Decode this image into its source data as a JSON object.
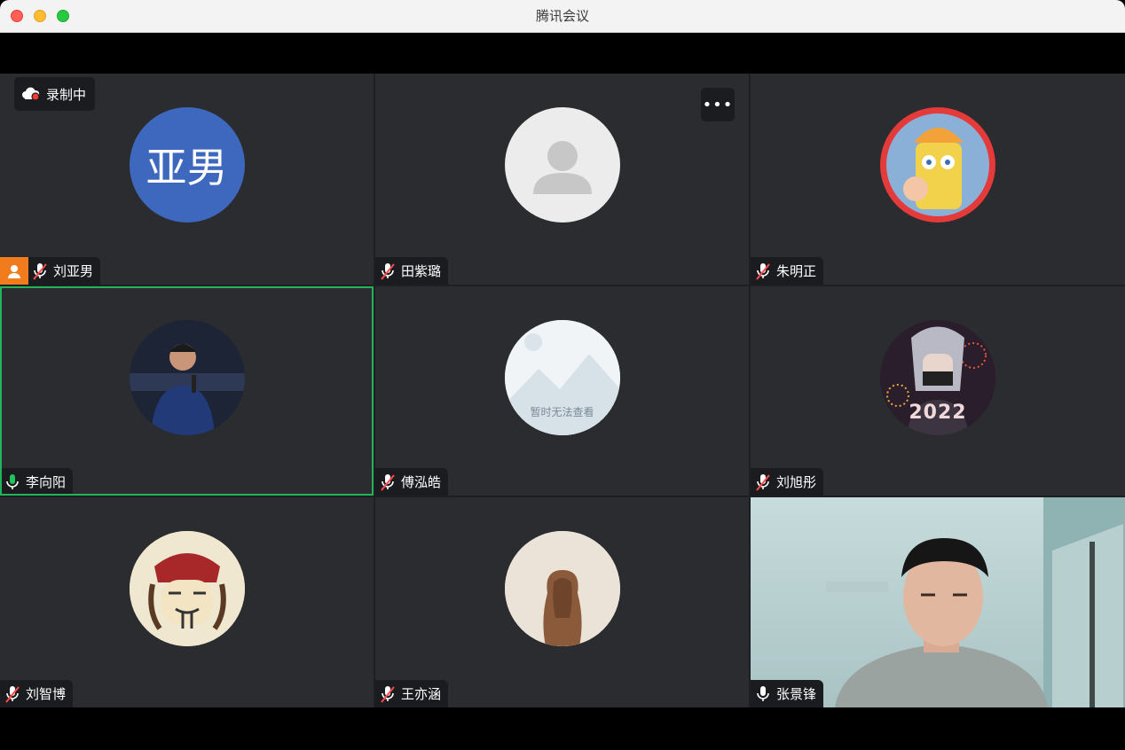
{
  "window": {
    "title": "腾讯会议"
  },
  "recording": {
    "label": "录制中"
  },
  "more_button": {
    "label": "•••"
  },
  "participants": [
    {
      "name": "刘亚男",
      "initials": "亚男",
      "mic": "muted",
      "host": true,
      "avatar": "initials-avatar"
    },
    {
      "name": "田紫璐",
      "mic": "muted",
      "avatar": "default-person-avatar"
    },
    {
      "name": "朱明正",
      "mic": "muted",
      "avatar": "cartoon-avatar"
    },
    {
      "name": "李向阳",
      "mic": "active",
      "speaking": true,
      "avatar": "photo-avatar"
    },
    {
      "name": "傅泓皓",
      "mic": "muted",
      "avatar": "unavailable-image-avatar",
      "avatar_text": "暂时无法查看"
    },
    {
      "name": "刘旭彤",
      "mic": "muted",
      "avatar": "anime-avatar",
      "avatar_text": "2022"
    },
    {
      "name": "刘智博",
      "mic": "muted",
      "avatar": "cartoon-pirate-avatar"
    },
    {
      "name": "王亦涵",
      "mic": "muted",
      "avatar": "photo-avatar"
    },
    {
      "name": "张景锋",
      "mic": "on",
      "avatar": "live-camera-video"
    }
  ],
  "colors": {
    "active_speaker_border": "#23b35a",
    "muted_icon": "#ff4a4a",
    "host_badge": "#f07c1e",
    "initials_avatar": "#3e68bd"
  }
}
